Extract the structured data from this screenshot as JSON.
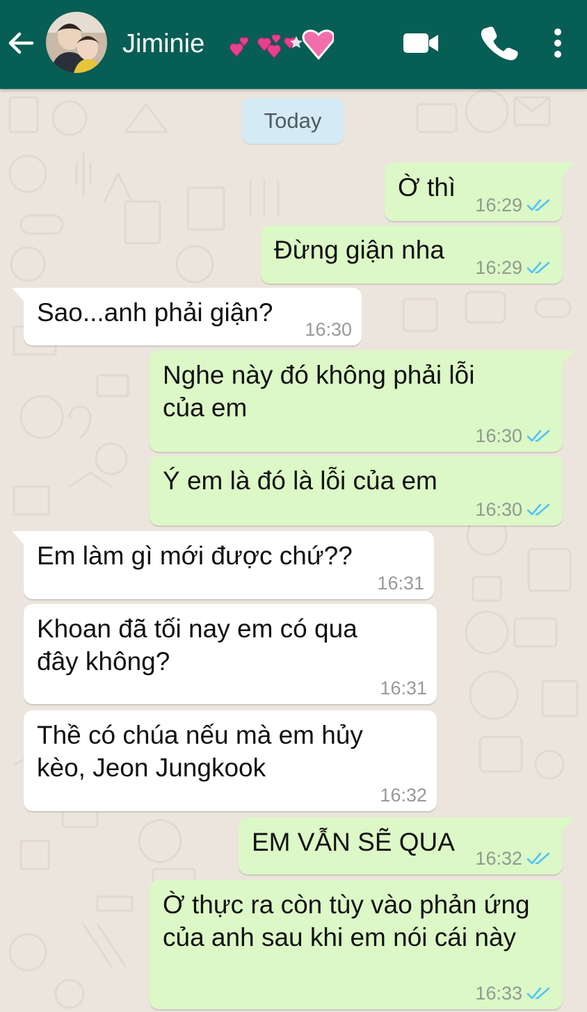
{
  "colors": {
    "header": "#075e54",
    "background": "#ece5dd",
    "outgoing_bubble": "#dcf8c6",
    "incoming_bubble": "#ffffff",
    "date_chip": "#d4eaf4",
    "read_ticks": "#4fc3f7"
  },
  "header": {
    "contact_name": "Jiminie",
    "icons": [
      "back-arrow-icon",
      "avatar",
      "hearts-emoji",
      "video-camera-icon",
      "phone-icon",
      "more-vert-icon"
    ]
  },
  "chat": {
    "date_label": "Today",
    "messages": [
      {
        "direction": "outgoing",
        "text": "Ờ thì",
        "time": "16:29",
        "status": "read"
      },
      {
        "direction": "outgoing",
        "text": "Đừng giận nha",
        "time": "16:29",
        "status": "read"
      },
      {
        "direction": "incoming",
        "text": "Sao...anh phải giận?",
        "time": "16:30"
      },
      {
        "direction": "outgoing",
        "text": "Nghe này đó không phải lỗi của em",
        "time": "16:30",
        "status": "read"
      },
      {
        "direction": "outgoing",
        "text": "Ý em là đó là lỗi của em",
        "time": "16:30",
        "status": "read"
      },
      {
        "direction": "incoming",
        "text": "Em làm gì mới được chứ??",
        "time": "16:31"
      },
      {
        "direction": "incoming",
        "text": "Khoan đã tối nay em có qua đây không?",
        "time": "16:31"
      },
      {
        "direction": "incoming",
        "text": "Thề có chúa nếu mà em hủy kèo, Jeon Jungkook",
        "time": "16:32"
      },
      {
        "direction": "outgoing",
        "text": "EM VẪN SẼ QUA",
        "time": "16:32",
        "status": "read"
      },
      {
        "direction": "outgoing",
        "text": "Ờ thực ra còn tùy vào phản ứng của anh sau khi em nói cái này",
        "time": "16:33",
        "status": "read"
      }
    ]
  }
}
